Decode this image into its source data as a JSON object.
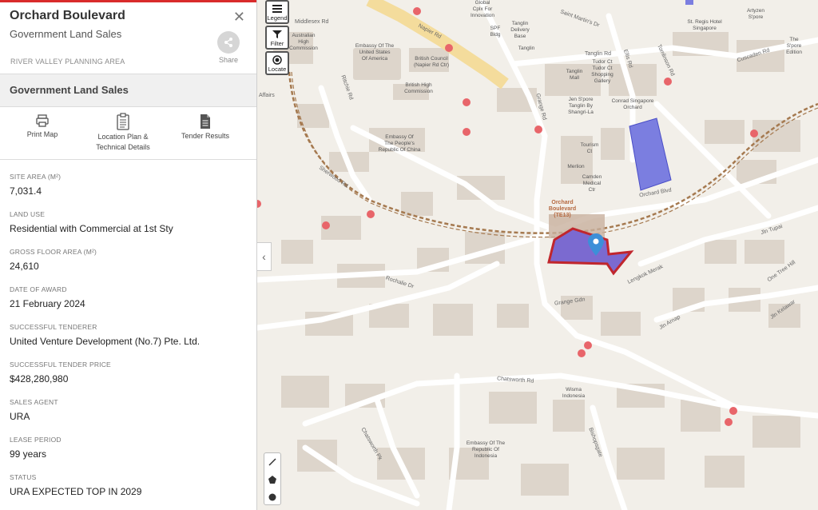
{
  "panel": {
    "title": "Orchard Boulevard",
    "subtitle": "Government Land Sales",
    "planning_area": "RIVER VALLEY PLANNING AREA",
    "share_label": "Share",
    "section_title": "Government Land Sales",
    "actions": [
      {
        "icon": "printer-icon",
        "label": "Print Map"
      },
      {
        "icon": "clipboard-icon",
        "label": "Location Plan &\nTechnical Details"
      },
      {
        "icon": "document-icon",
        "label": "Tender Results"
      }
    ],
    "fields": [
      {
        "label": "SITE AREA (M²)",
        "value": "7,031.4"
      },
      {
        "label": "LAND USE",
        "value": "Residential with Commercial at 1st Sty"
      },
      {
        "label": "GROSS FLOOR AREA (M²)",
        "value": "24,610"
      },
      {
        "label": "DATE OF AWARD",
        "value": "21 February 2024"
      },
      {
        "label": "SUCCESSFUL TENDERER",
        "value": "United Venture Development (No.7) Pte. Ltd."
      },
      {
        "label": "SUCCESSFUL TENDER PRICE",
        "value": "$428,280,980"
      },
      {
        "label": "SALES AGENT",
        "value": "URA"
      },
      {
        "label": "LEASE PERIOD",
        "value": "99 years"
      },
      {
        "label": "STATUS",
        "value": "URA EXPECTED TOP IN 2029"
      }
    ]
  },
  "map_controls": {
    "legend": "Legend",
    "filter": "Filter",
    "locate": "Locate",
    "collapse": "‹"
  },
  "map_labels": {
    "places": [
      "Embassy Of The\nUnited States\nOf America",
      "British Council\n(Napier Rd Ctr)",
      "British High\nCommission",
      "Embassy Of\nThe People's\nRepublic Of China",
      "Australian\nHigh\nCommission",
      "Global\nCplx For\nInnovation",
      "SPF\nBldg",
      "Tanglin\nDelivery\nBase",
      "Tanglin",
      "Tanglin\nMall",
      "Tudor Ct\nTudor Ct\nShopping\nGallery",
      "Jen S'pore\nTanglin By\nShangri-La",
      "Conrad Singapore\nOrchard",
      "St. Regis Hotel\nSingapore",
      "Artyzen\nS'pore",
      "The S'pore\nEdition",
      "Tourism\nCt",
      "Merlion",
      "Camden\nMedical\nCtr",
      "Wisma\nIndonesia",
      "Embassy Of The\nRepublic Of\nIndonesia"
    ],
    "mrt": "Orchard\nBoulevard\n(TE13)",
    "roads": [
      "Napier Rd",
      "Middlesex Rd",
      "Saint Martin's Dr",
      "Tanglin Rd",
      "Cuscaden Rd",
      "Ellis Rd",
      "Tomlinson Rd",
      "Orchard Blvd",
      "Grange Rd",
      "Ritchie Rd",
      "Sherwood Rd",
      "Rochalie Dr",
      "Jln Tupai",
      "One Tree Hill",
      "Lengkok Merak",
      "Grange Gdn",
      "Jln Arnap",
      "Jln Kelawar",
      "Chatsworth Rd",
      "Chatsworth Pk",
      "Bishopsgate",
      "Affairs"
    ]
  }
}
